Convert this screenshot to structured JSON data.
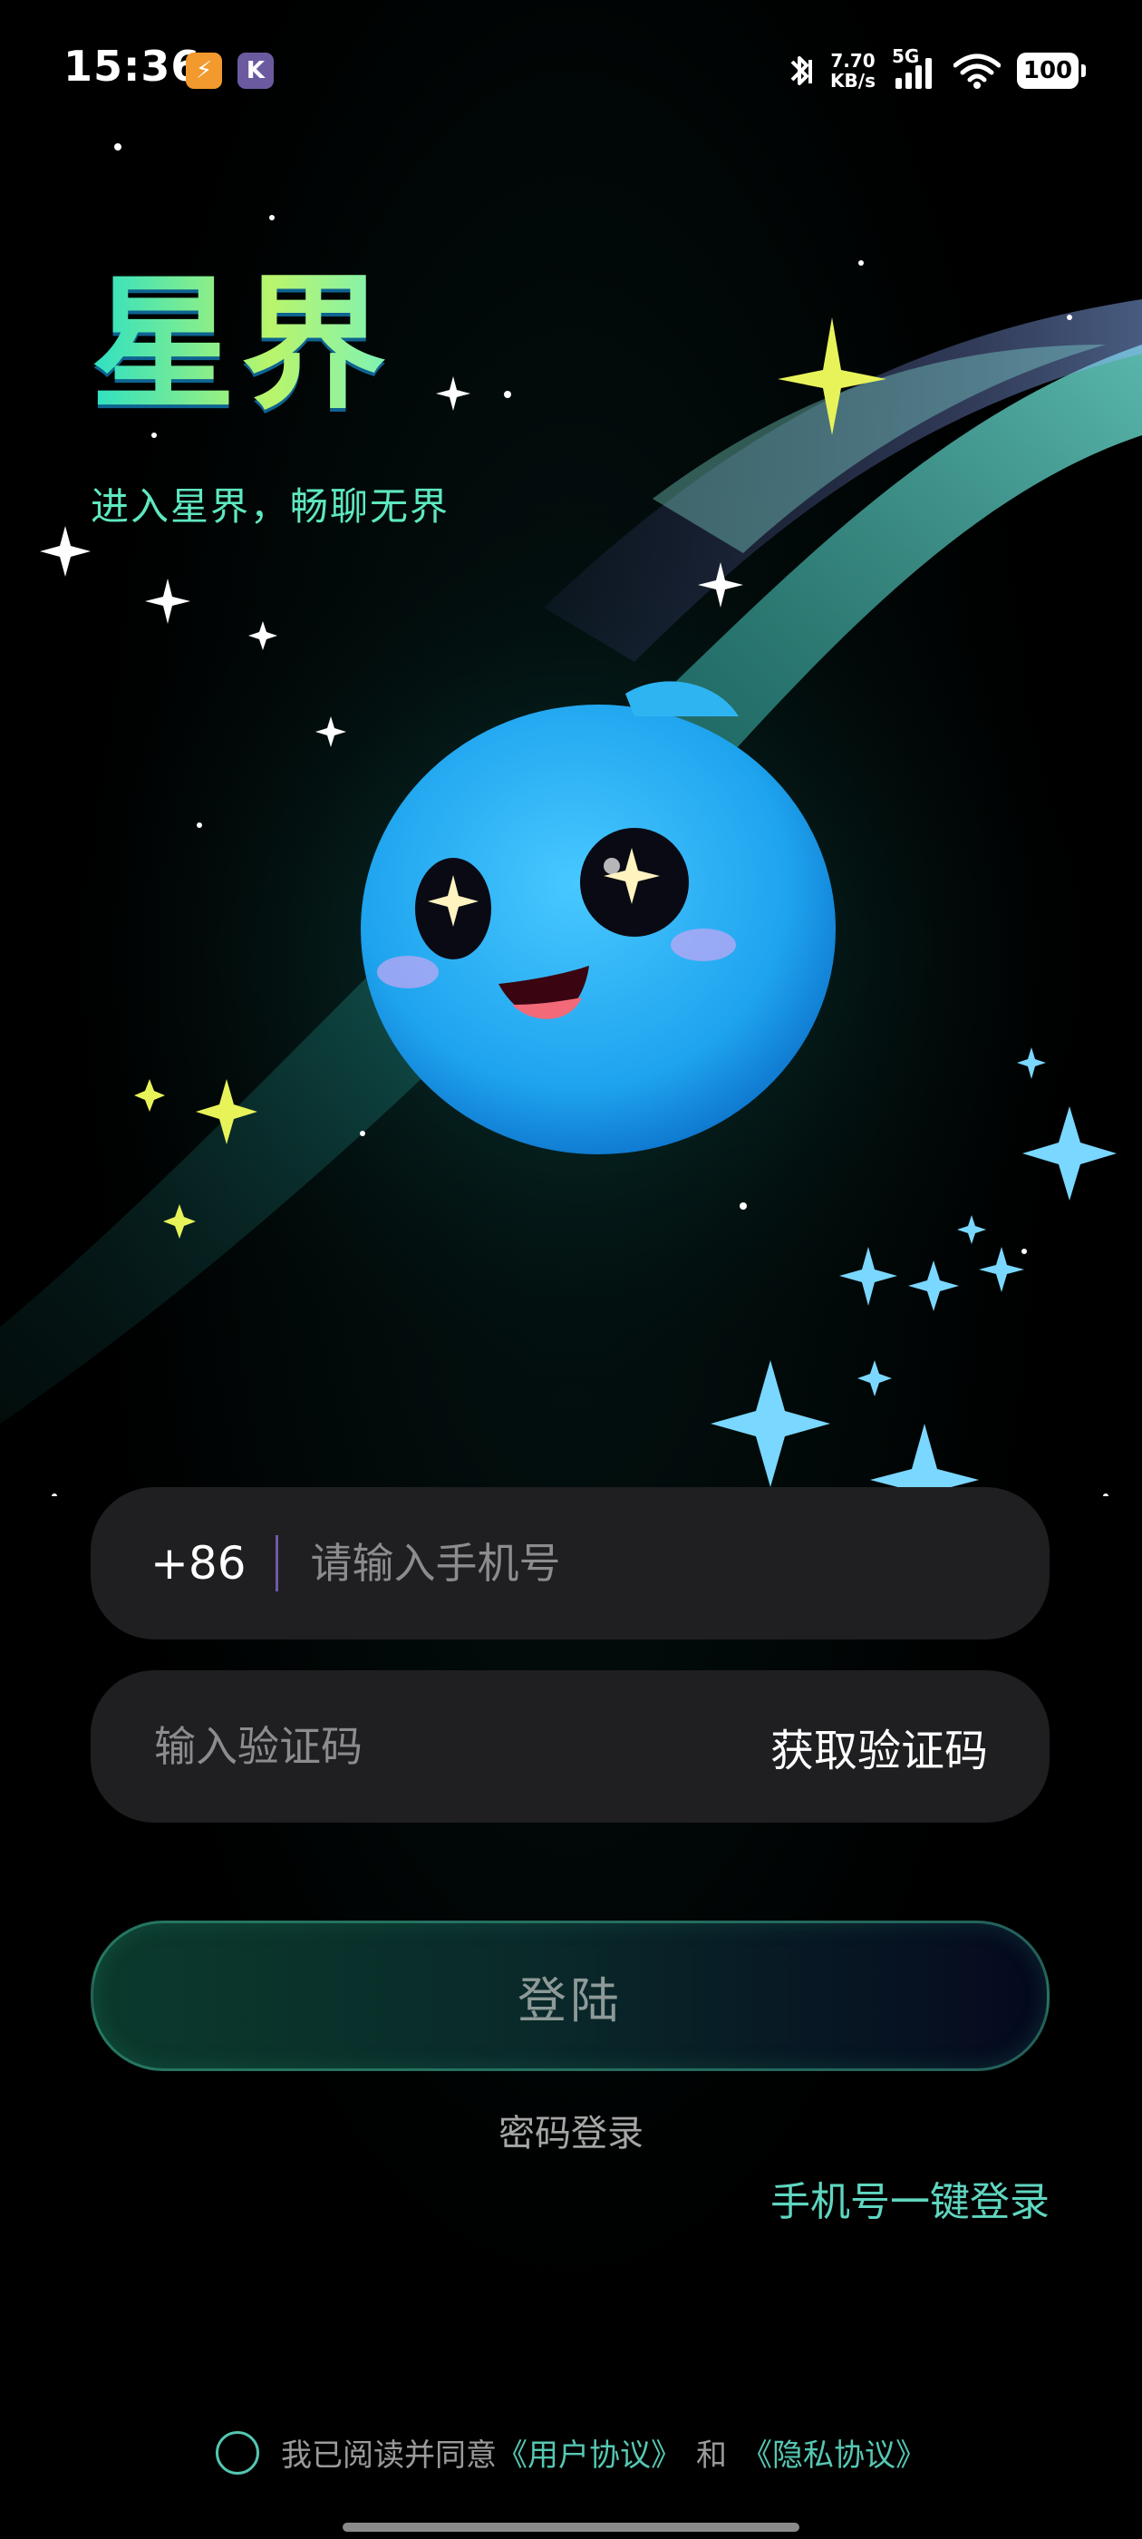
{
  "status_bar": {
    "time": "15:36",
    "badge_1": "⚡",
    "badge_2": "K",
    "net_speed_value": "7.70",
    "net_speed_unit": "KB/s",
    "network": "5G",
    "battery": "100"
  },
  "hero": {
    "title": "星界",
    "slogan": "进入星界，畅聊无界"
  },
  "form": {
    "country_code": "+86",
    "phone_placeholder": "请输入手机号",
    "code_placeholder": "输入验证码",
    "get_code_label": "获取验证码",
    "login_label": "登陆",
    "password_login_label": "密码登录",
    "onekey_login_label": "手机号一键登录"
  },
  "agreement": {
    "prefix": "我已阅读并同意",
    "user_agreement": "《用户协议》",
    "and": "和",
    "privacy_agreement": "《隐私协议》"
  },
  "colors": {
    "accent": "#5fd6c0",
    "mascot": "#2fb4f2",
    "background": "#000000"
  }
}
